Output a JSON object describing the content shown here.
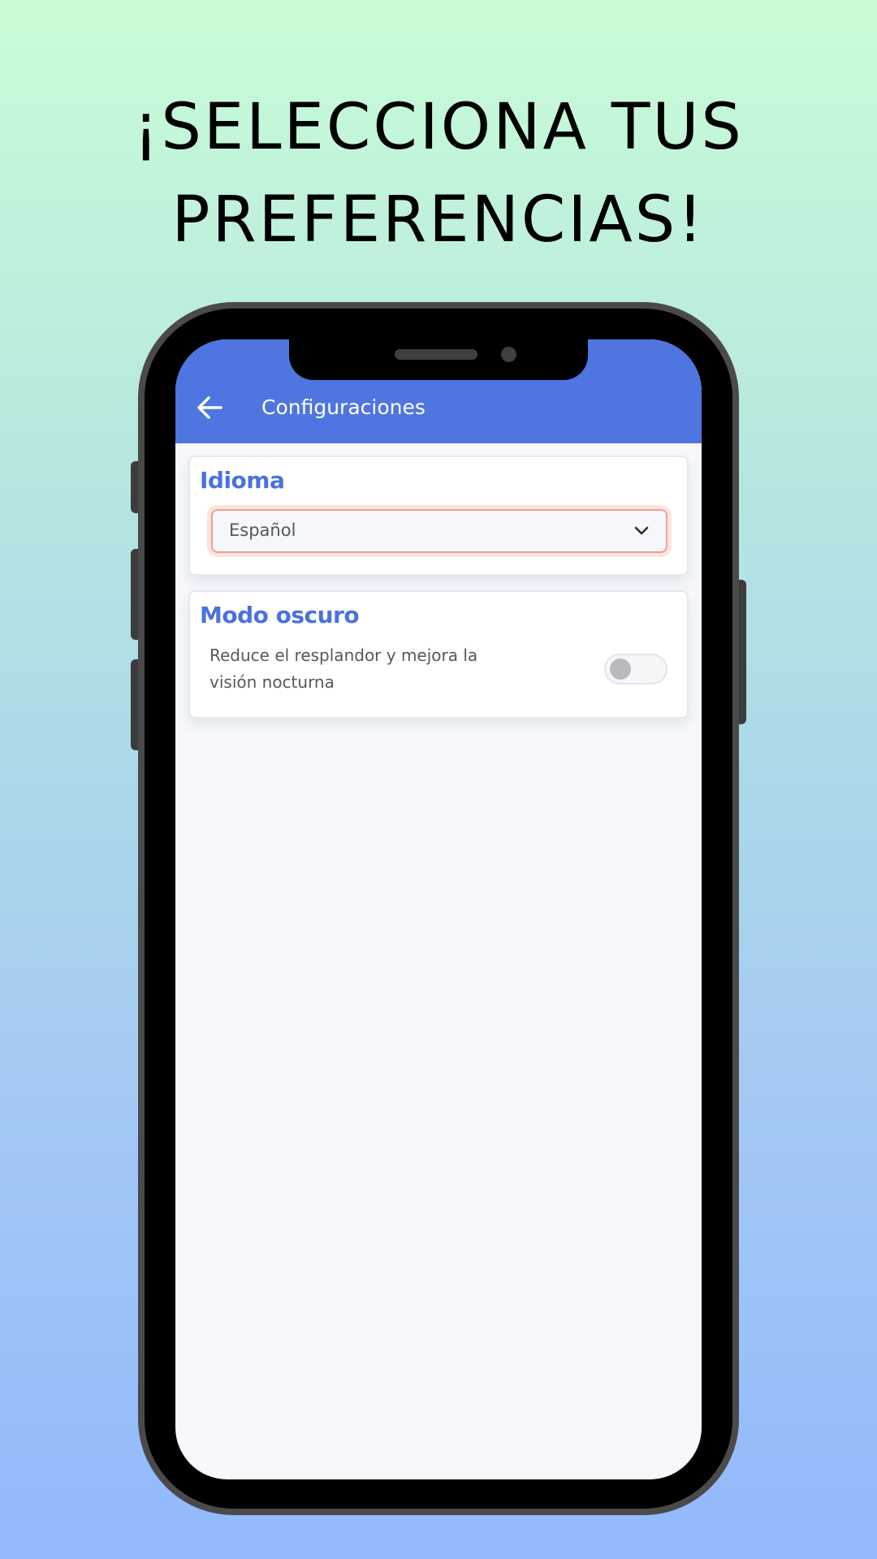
{
  "headline": {
    "line1": "¡SELECCIONA TUS",
    "line2": "PREFERENCIAS!"
  },
  "appbar": {
    "title": "Configuraciones",
    "back_icon": "arrow-left-icon"
  },
  "language_card": {
    "title": "Idioma",
    "selected": "Español",
    "dropdown_icon": "chevron-down-icon"
  },
  "dark_mode_card": {
    "title": "Modo oscuro",
    "description_line1": "Reduce el resplandor y mejora la",
    "description_line2": "visión nocturna",
    "enabled": false
  },
  "colors": {
    "accent": "#4f75e0",
    "title_blue": "#4a72dc",
    "select_border": "#f0a092"
  }
}
